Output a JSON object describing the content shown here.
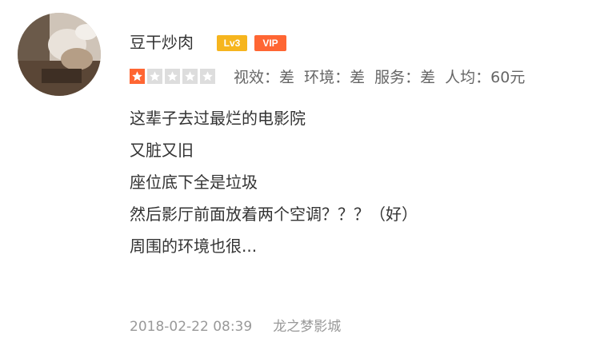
{
  "review": {
    "username": "豆干炒肉",
    "level_badge": "Lv3",
    "vip_badge": "VIP",
    "star_rating": 1,
    "star_max": 5,
    "scores": [
      {
        "label": "视效",
        "value": "差"
      },
      {
        "label": "环境",
        "value": "差"
      },
      {
        "label": "服务",
        "value": "差"
      },
      {
        "label": "人均",
        "value": "60元"
      }
    ],
    "content_lines": [
      "这辈子去过最烂的电影院",
      "又脏又旧",
      "座位底下全是垃圾",
      "然后影厅前面放着两个空调？？？（好）",
      "周围的环境也很..."
    ],
    "timestamp": "2018-02-22 08:39",
    "shop_name": "龙之梦影城"
  },
  "colors": {
    "star_filled": "#ff6633",
    "star_empty": "#dddddd",
    "level_badge": "#f6b51e",
    "vip_badge": "#ff6633"
  }
}
